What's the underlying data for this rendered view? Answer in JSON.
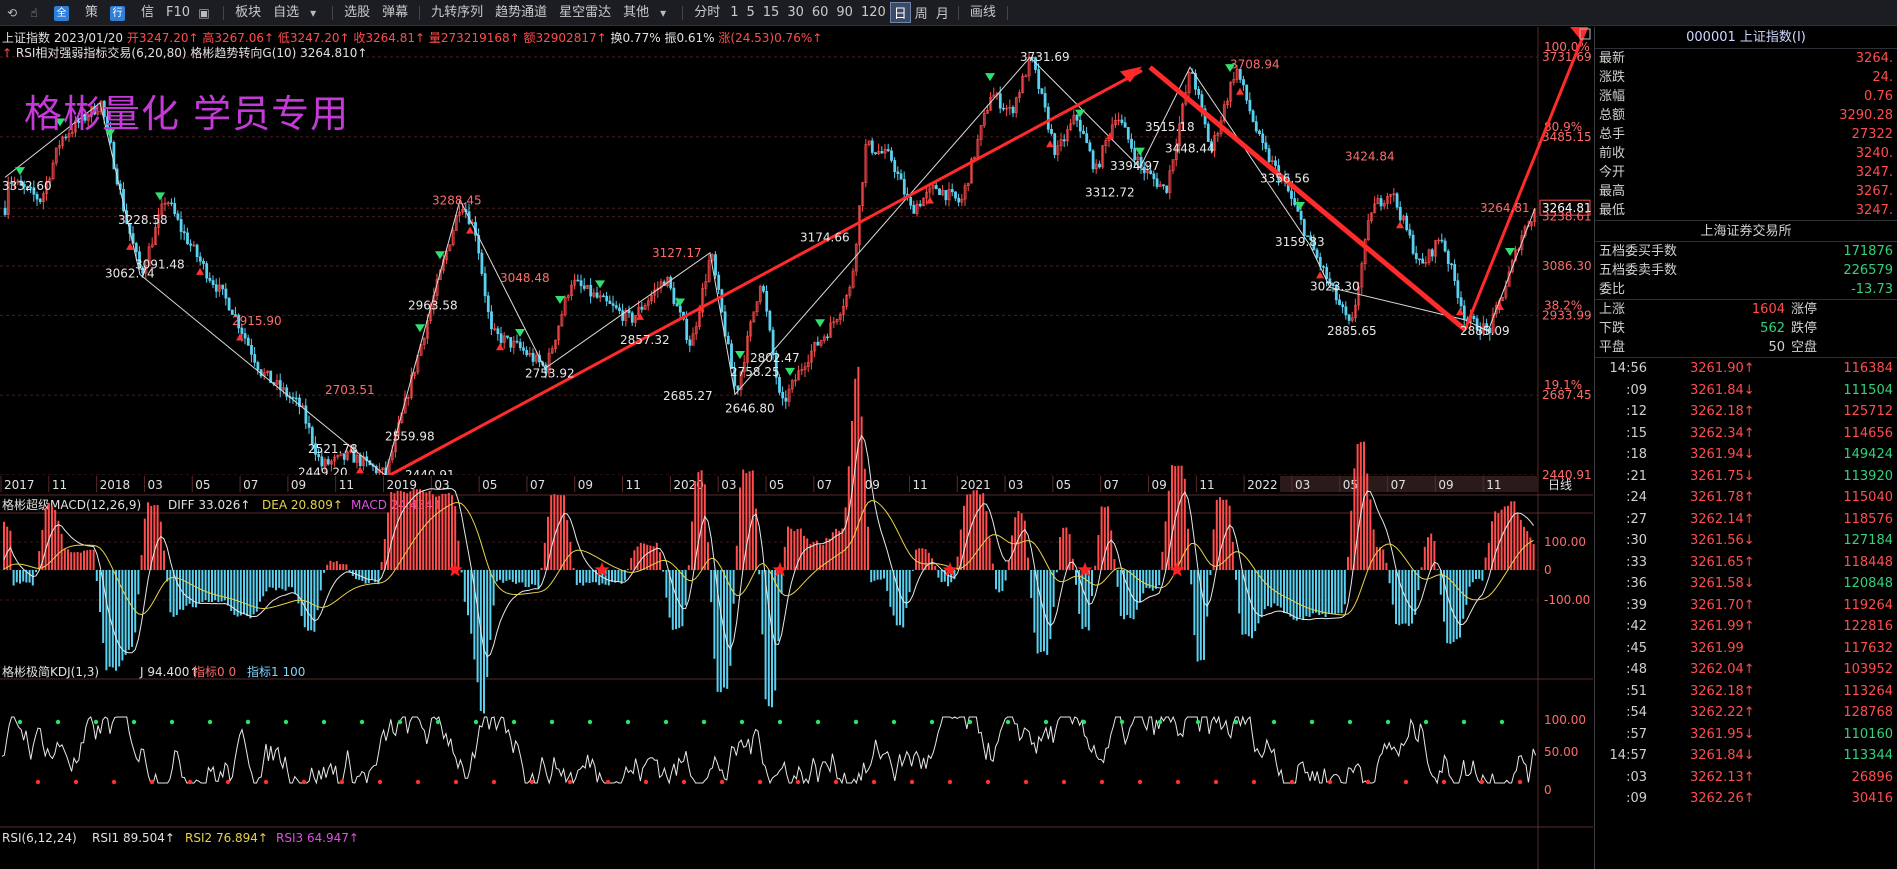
{
  "toolbar": {
    "items": [
      "策",
      "信",
      "F10",
      "板块",
      "自选",
      "选股",
      "弹幕",
      "九转序列",
      "趋势通道",
      "星空雷达",
      "其他",
      "分时"
    ],
    "badges": [
      "全",
      "行"
    ],
    "periods": [
      "1",
      "5",
      "15",
      "30",
      "60",
      "90",
      "120",
      "日",
      "周",
      "月"
    ],
    "active_period": "日",
    "draw_label": "画线"
  },
  "info": {
    "line1": {
      "name": "上证指数",
      "date": "2023/01/20",
      "open": "开3247.20↑",
      "high": "高3267.06↑",
      "low": "低3247.20↑",
      "close": "收3264.81↑",
      "volume": "量273219168↑",
      "amount": "额329028​17↑",
      "turnover": "换0.77%",
      "amplitude": "振0.61%",
      "change": "涨(24.53)0.76%↑"
    },
    "line2": {
      "indicator": "RSI相对强弱指标交易(6,20,80)",
      "trend": "格彬趋势转向G(10)",
      "trend_value": "3264.810↑"
    },
    "watermark": "格彬量化 学员专用"
  },
  "price_axis": {
    "levels": [
      {
        "value": "3731.69",
        "pct": "100.0%"
      },
      {
        "value": "3485.15",
        "pct": "80.9%"
      },
      {
        "value": "3264.81",
        "pct": ""
      },
      {
        "value": "3238.61",
        "pct": ""
      },
      {
        "value": "3086.30",
        "pct": ""
      },
      {
        "value": "2933.99",
        "pct": "38.2%"
      },
      {
        "value": "2687.45",
        "pct": "19.1%"
      },
      {
        "value": "2440.91",
        "pct": ""
      }
    ]
  },
  "time_axis": {
    "labels": [
      "2017",
      "11",
      "2018",
      "03",
      "05",
      "07",
      "09",
      "11",
      "2019",
      "03",
      "05",
      "07",
      "09",
      "11",
      "2020",
      "03",
      "05",
      "07",
      "09",
      "11",
      "2021",
      "03",
      "05",
      "07",
      "09",
      "11",
      "2022",
      "03",
      "05",
      "07",
      "09",
      "11"
    ],
    "period_label": "日线"
  },
  "annotations": [
    {
      "text": "3731.69",
      "color": "white"
    },
    {
      "text": "3708.94",
      "color": "red"
    },
    {
      "text": "3515.18",
      "color": "white"
    },
    {
      "text": "3448.44",
      "color": "white"
    },
    {
      "text": "3424.84",
      "color": "red"
    },
    {
      "text": "3394.97",
      "color": "white"
    },
    {
      "text": "3356.56",
      "color": "white"
    },
    {
      "text": "3312.72",
      "color": "white"
    },
    {
      "text": "3288.45",
      "color": "red"
    },
    {
      "text": "3228.58",
      "color": "white"
    },
    {
      "text": "3174.66",
      "color": "white"
    },
    {
      "text": "3159.83",
      "color": "white"
    },
    {
      "text": "3127.17",
      "color": "red"
    },
    {
      "text": "3091.48",
      "color": "white"
    },
    {
      "text": "3062.74",
      "color": "white"
    },
    {
      "text": "3048.48",
      "color": "red"
    },
    {
      "text": "3023.30",
      "color": "white"
    },
    {
      "text": "2963.58",
      "color": "white"
    },
    {
      "text": "2915.90",
      "color": "red"
    },
    {
      "text": "2885.65",
      "color": "white"
    },
    {
      "text": "2885.09",
      "color": "white"
    },
    {
      "text": "2857.32",
      "color": "white"
    },
    {
      "text": "2802.47",
      "color": "white"
    },
    {
      "text": "2753.92",
      "color": "white"
    },
    {
      "text": "2758.25",
      "color": "white"
    },
    {
      "text": "2703.51",
      "color": "red"
    },
    {
      "text": "2685.27",
      "color": "white"
    },
    {
      "text": "2646.80",
      "color": "white"
    },
    {
      "text": "2559.98",
      "color": "white"
    },
    {
      "text": "2521.78",
      "color": "white"
    },
    {
      "text": "2449.20",
      "color": "white"
    },
    {
      "text": "2440.91",
      "color": "white"
    },
    {
      "text": "3332.60",
      "color": "white"
    },
    {
      "text": "3264.81",
      "color": "red"
    }
  ],
  "macd": {
    "title": "格彬超级MACD(12,26,9)",
    "diff": "DIFF 33.026↑",
    "dea": "DEA 20.809↑",
    "macd": "MACD 24.434↑",
    "axis": [
      "100.00",
      "0",
      "-100.00"
    ]
  },
  "kdj": {
    "title": "格彬极简KDJ(1,3)",
    "j": "J 94.400↑",
    "ind0": "指标0 0",
    "ind1": "指标1 100",
    "axis": [
      "100.00",
      "50.00",
      "0"
    ]
  },
  "rsi": {
    "title": "RSI(6,12,24)",
    "rsi1": "RSI1 89.504↑",
    "rsi2": "RSI2 76.894↑",
    "rsi3": "RSI3 64.947↑"
  },
  "quote": {
    "title": "000001 上证指数(I)",
    "rows": [
      {
        "label": "最新",
        "value": "3264."
      },
      {
        "label": "涨跌",
        "value": "24."
      },
      {
        "label": "涨幅",
        "value": "0.76"
      },
      {
        "label": "总额",
        "value": "3290.28"
      },
      {
        "label": "总手",
        "value": "27322"
      },
      {
        "label": "前收",
        "value": "3240."
      },
      {
        "label": "今开",
        "value": "3247."
      },
      {
        "label": "最高",
        "value": "3267."
      },
      {
        "label": "最低",
        "value": "3247."
      }
    ],
    "exchange": "上海证券交易所",
    "orders": [
      {
        "label": "五档委买手数",
        "value": "171876"
      },
      {
        "label": "五档委卖手数",
        "value": "226579"
      },
      {
        "label": "委比",
        "value": "-13.73"
      }
    ],
    "breadth": [
      {
        "label": "上涨",
        "value": "1604",
        "label2": "涨停",
        "color": "#ff4d4d"
      },
      {
        "label": "下跌",
        "value": "562",
        "label2": "跌停",
        "color": "#34d17b"
      },
      {
        "label": "平盘",
        "value": "50",
        "label2": "空盘",
        "color": "#d0d0d0"
      }
    ],
    "ticks": [
      {
        "time": "14:56",
        "price": "3261.90↑",
        "vol": "116384",
        "dir": "up"
      },
      {
        "time": ":09",
        "price": "3261.84↓",
        "vol": "111504",
        "dir": "down"
      },
      {
        "time": ":12",
        "price": "3262.18↑",
        "vol": "125712",
        "dir": "up"
      },
      {
        "time": ":15",
        "price": "3262.34↑",
        "vol": "114656",
        "dir": "up"
      },
      {
        "time": ":18",
        "price": "3261.94↓",
        "vol": "149424",
        "dir": "down"
      },
      {
        "time": ":21",
        "price": "3261.75↓",
        "vol": "113920",
        "dir": "down"
      },
      {
        "time": ":24",
        "price": "3261.78↑",
        "vol": "115040",
        "dir": "up"
      },
      {
        "time": ":27",
        "price": "3262.14↑",
        "vol": "118576",
        "dir": "up"
      },
      {
        "time": ":30",
        "price": "3261.56↓",
        "vol": "127184",
        "dir": "down"
      },
      {
        "time": ":33",
        "price": "3261.65↑",
        "vol": "118448",
        "dir": "up"
      },
      {
        "time": ":36",
        "price": "3261.58↓",
        "vol": "120848",
        "dir": "down"
      },
      {
        "time": ":39",
        "price": "3261.70↑",
        "vol": "119264",
        "dir": "up"
      },
      {
        "time": ":42",
        "price": "3261.99↑",
        "vol": "122816",
        "dir": "up"
      },
      {
        "time": ":45",
        "price": "3261.99",
        "vol": "117632",
        "dir": "flat"
      },
      {
        "time": ":48",
        "price": "3262.04↑",
        "vol": "103952",
        "dir": "up"
      },
      {
        "time": ":51",
        "price": "3262.18↑",
        "vol": "113264",
        "dir": "up"
      },
      {
        "time": ":54",
        "price": "3262.22↑",
        "vol": "128768",
        "dir": "up"
      },
      {
        "time": ":57",
        "price": "3261.95↓",
        "vol": "110160",
        "dir": "down"
      },
      {
        "time": "14:57",
        "price": "3261.84↓",
        "vol": "113344",
        "dir": "down"
      },
      {
        "time": ":03",
        "price": "3262.13↑",
        "vol": "26896",
        "dir": "up"
      },
      {
        "time": ":09",
        "price": "3262.26↑",
        "vol": "30416",
        "dir": "up"
      }
    ]
  },
  "colors": {
    "up": "#ff4d4d",
    "down": "#34d17b",
    "trend_arrow": "#ff2a2a",
    "toolbar_bg": "#1b1d22"
  }
}
